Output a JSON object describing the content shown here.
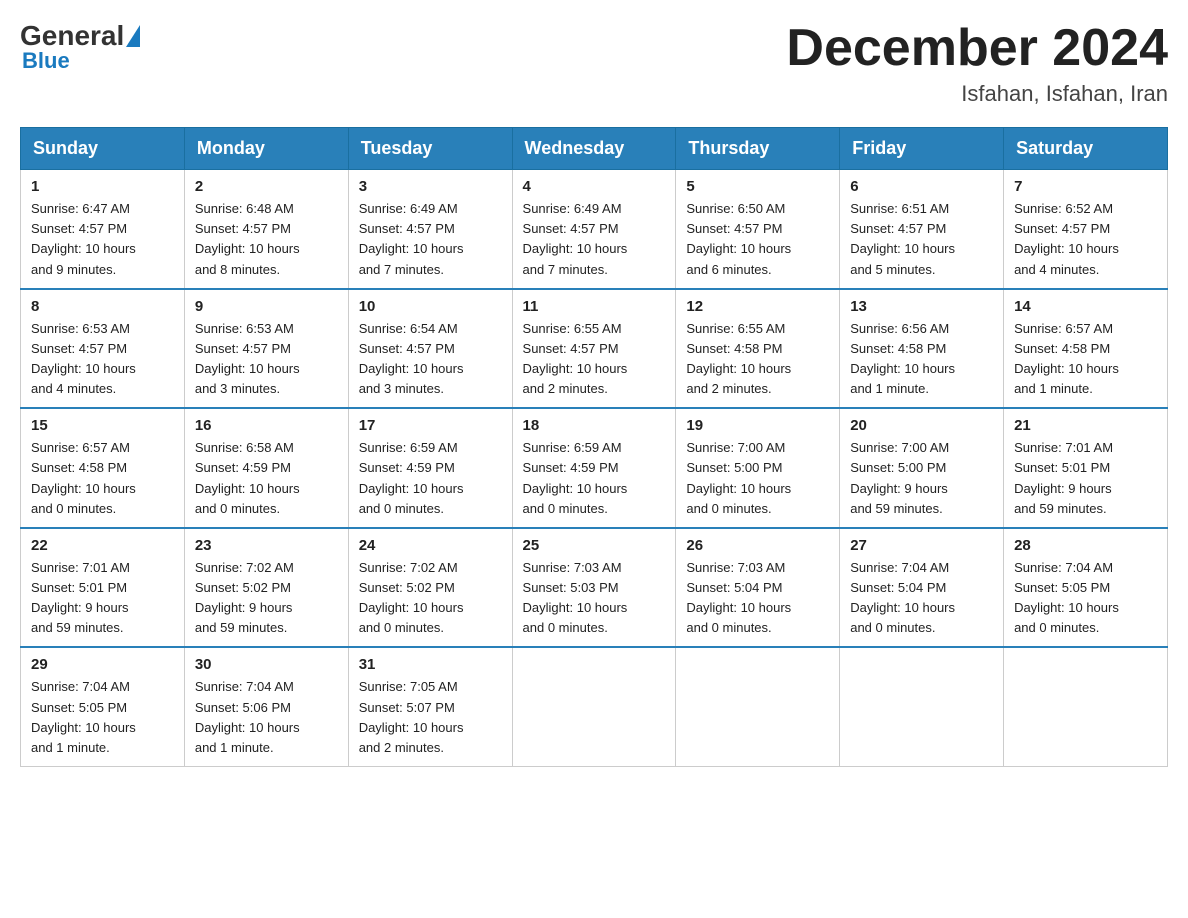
{
  "header": {
    "logo_general": "General",
    "logo_blue": "Blue",
    "month_title": "December 2024",
    "location": "Isfahan, Isfahan, Iran"
  },
  "days_of_week": [
    "Sunday",
    "Monday",
    "Tuesday",
    "Wednesday",
    "Thursday",
    "Friday",
    "Saturday"
  ],
  "weeks": [
    [
      {
        "num": "1",
        "sunrise": "6:47 AM",
        "sunset": "4:57 PM",
        "daylight": "10 hours and 9 minutes."
      },
      {
        "num": "2",
        "sunrise": "6:48 AM",
        "sunset": "4:57 PM",
        "daylight": "10 hours and 8 minutes."
      },
      {
        "num": "3",
        "sunrise": "6:49 AM",
        "sunset": "4:57 PM",
        "daylight": "10 hours and 7 minutes."
      },
      {
        "num": "4",
        "sunrise": "6:49 AM",
        "sunset": "4:57 PM",
        "daylight": "10 hours and 7 minutes."
      },
      {
        "num": "5",
        "sunrise": "6:50 AM",
        "sunset": "4:57 PM",
        "daylight": "10 hours and 6 minutes."
      },
      {
        "num": "6",
        "sunrise": "6:51 AM",
        "sunset": "4:57 PM",
        "daylight": "10 hours and 5 minutes."
      },
      {
        "num": "7",
        "sunrise": "6:52 AM",
        "sunset": "4:57 PM",
        "daylight": "10 hours and 4 minutes."
      }
    ],
    [
      {
        "num": "8",
        "sunrise": "6:53 AM",
        "sunset": "4:57 PM",
        "daylight": "10 hours and 4 minutes."
      },
      {
        "num": "9",
        "sunrise": "6:53 AM",
        "sunset": "4:57 PM",
        "daylight": "10 hours and 3 minutes."
      },
      {
        "num": "10",
        "sunrise": "6:54 AM",
        "sunset": "4:57 PM",
        "daylight": "10 hours and 3 minutes."
      },
      {
        "num": "11",
        "sunrise": "6:55 AM",
        "sunset": "4:57 PM",
        "daylight": "10 hours and 2 minutes."
      },
      {
        "num": "12",
        "sunrise": "6:55 AM",
        "sunset": "4:58 PM",
        "daylight": "10 hours and 2 minutes."
      },
      {
        "num": "13",
        "sunrise": "6:56 AM",
        "sunset": "4:58 PM",
        "daylight": "10 hours and 1 minute."
      },
      {
        "num": "14",
        "sunrise": "6:57 AM",
        "sunset": "4:58 PM",
        "daylight": "10 hours and 1 minute."
      }
    ],
    [
      {
        "num": "15",
        "sunrise": "6:57 AM",
        "sunset": "4:58 PM",
        "daylight": "10 hours and 0 minutes."
      },
      {
        "num": "16",
        "sunrise": "6:58 AM",
        "sunset": "4:59 PM",
        "daylight": "10 hours and 0 minutes."
      },
      {
        "num": "17",
        "sunrise": "6:59 AM",
        "sunset": "4:59 PM",
        "daylight": "10 hours and 0 minutes."
      },
      {
        "num": "18",
        "sunrise": "6:59 AM",
        "sunset": "4:59 PM",
        "daylight": "10 hours and 0 minutes."
      },
      {
        "num": "19",
        "sunrise": "7:00 AM",
        "sunset": "5:00 PM",
        "daylight": "10 hours and 0 minutes."
      },
      {
        "num": "20",
        "sunrise": "7:00 AM",
        "sunset": "5:00 PM",
        "daylight": "9 hours and 59 minutes."
      },
      {
        "num": "21",
        "sunrise": "7:01 AM",
        "sunset": "5:01 PM",
        "daylight": "9 hours and 59 minutes."
      }
    ],
    [
      {
        "num": "22",
        "sunrise": "7:01 AM",
        "sunset": "5:01 PM",
        "daylight": "9 hours and 59 minutes."
      },
      {
        "num": "23",
        "sunrise": "7:02 AM",
        "sunset": "5:02 PM",
        "daylight": "9 hours and 59 minutes."
      },
      {
        "num": "24",
        "sunrise": "7:02 AM",
        "sunset": "5:02 PM",
        "daylight": "10 hours and 0 minutes."
      },
      {
        "num": "25",
        "sunrise": "7:03 AM",
        "sunset": "5:03 PM",
        "daylight": "10 hours and 0 minutes."
      },
      {
        "num": "26",
        "sunrise": "7:03 AM",
        "sunset": "5:04 PM",
        "daylight": "10 hours and 0 minutes."
      },
      {
        "num": "27",
        "sunrise": "7:04 AM",
        "sunset": "5:04 PM",
        "daylight": "10 hours and 0 minutes."
      },
      {
        "num": "28",
        "sunrise": "7:04 AM",
        "sunset": "5:05 PM",
        "daylight": "10 hours and 0 minutes."
      }
    ],
    [
      {
        "num": "29",
        "sunrise": "7:04 AM",
        "sunset": "5:05 PM",
        "daylight": "10 hours and 1 minute."
      },
      {
        "num": "30",
        "sunrise": "7:04 AM",
        "sunset": "5:06 PM",
        "daylight": "10 hours and 1 minute."
      },
      {
        "num": "31",
        "sunrise": "7:05 AM",
        "sunset": "5:07 PM",
        "daylight": "10 hours and 2 minutes."
      },
      null,
      null,
      null,
      null
    ]
  ],
  "labels": {
    "sunrise": "Sunrise:",
    "sunset": "Sunset:",
    "daylight": "Daylight:"
  }
}
